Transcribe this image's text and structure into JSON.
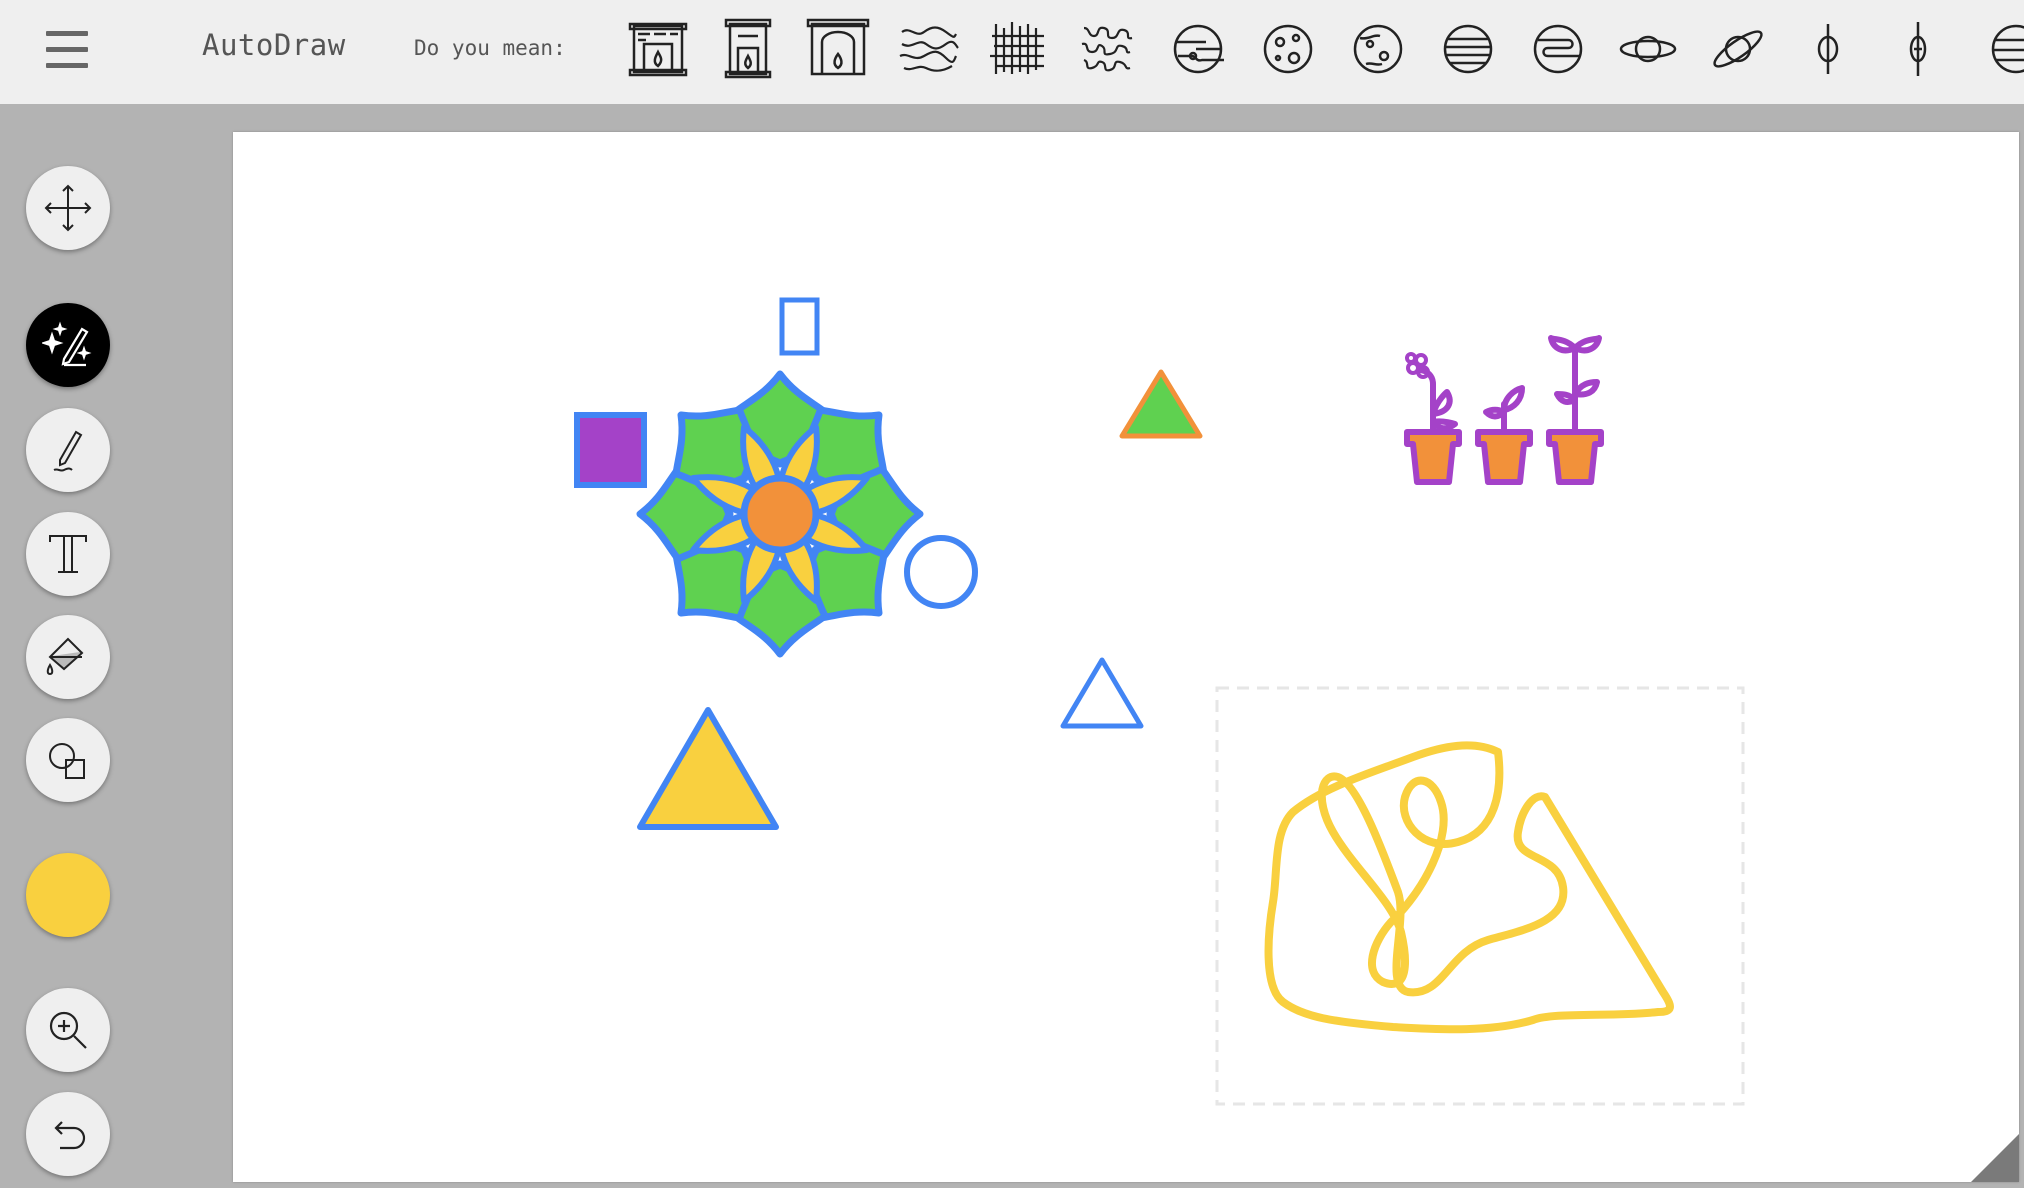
{
  "header": {
    "app_title": "AutoDraw",
    "suggestion_label": "Do you mean:",
    "suggestions": [
      "fireplace",
      "fireplace",
      "fireplace",
      "scribble",
      "scribble",
      "scribble",
      "planet",
      "planet",
      "planet",
      "planet",
      "planet",
      "planet",
      "planet",
      "planet",
      "planet",
      "planet"
    ]
  },
  "toolbar": {
    "tools": [
      "move-tool",
      "autodraw-tool",
      "draw-tool",
      "type-tool",
      "fill-tool",
      "shape-tool"
    ],
    "active_tool": "autodraw-tool",
    "current_color": "#f9d03f"
  },
  "colors": {
    "blue": "#4285f4",
    "green": "#5fd150",
    "yellow": "#f9d03f",
    "orange": "#f2913a",
    "purple": "#a442c8"
  }
}
